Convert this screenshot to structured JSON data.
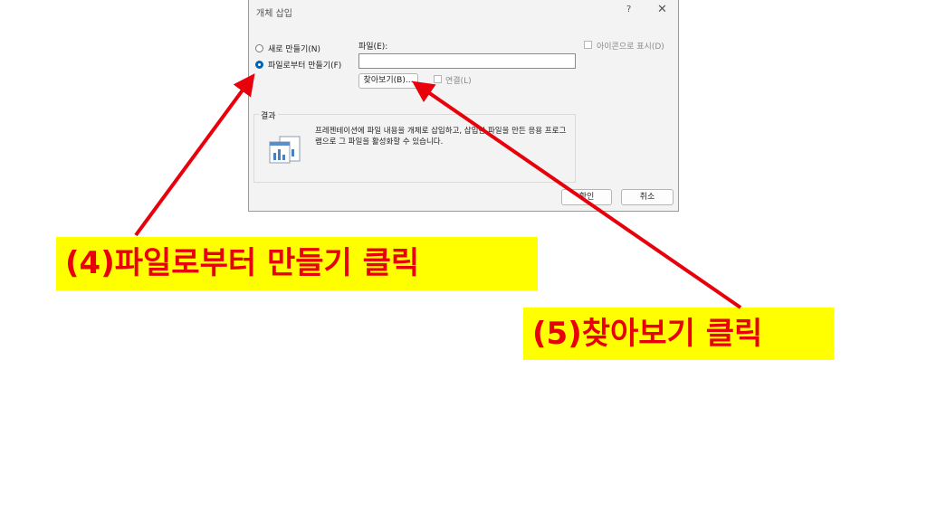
{
  "dialog": {
    "title": "개체 삽입",
    "help_label": "?",
    "close_label": "✕",
    "options": [
      {
        "label": "새로 만들기(N)",
        "selected": false
      },
      {
        "label": "파일로부터 만들기(F)",
        "selected": true
      }
    ],
    "file_label": "파일(E):",
    "file_value": "",
    "browse_label": "찾아보기(B)...",
    "link_label": "연결(L)",
    "display_icon_label": "아이콘으로 표시(D)",
    "result_title": "결과",
    "result_text": "프레젠테이션에 파일 내용을 개체로 삽입하고, 삽입한 파일을 만든 응용 프로그램으로 그 파일을 활성화할 수 있습니다.",
    "ok_label": "확인",
    "cancel_label": "취소"
  },
  "annotations": {
    "step4": "(4)파일로부터 만들기 클릭",
    "step5": "(5)찾아보기 클릭",
    "highlight_color": "#ffff00",
    "text_color": "#e8000b",
    "arrow_color": "#e8000b"
  }
}
